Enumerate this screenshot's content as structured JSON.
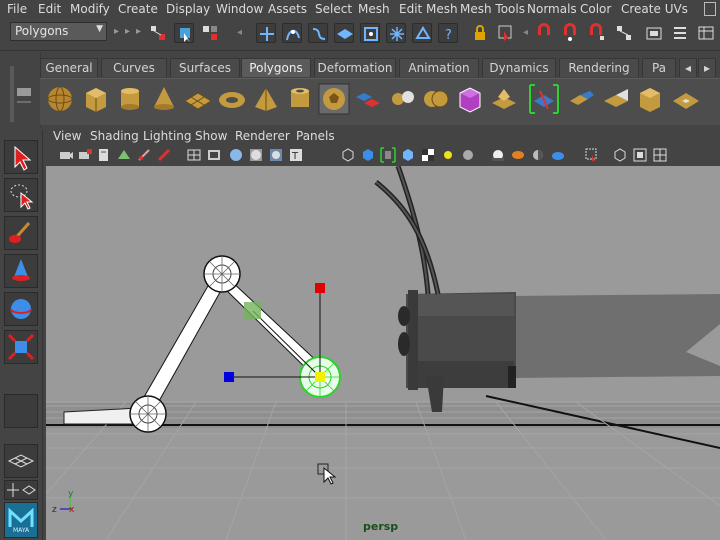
{
  "menubar": {
    "items": [
      "File",
      "Edit",
      "Modify",
      "Create",
      "Display",
      "Window",
      "Assets",
      "Select",
      "Mesh",
      "Edit Mesh",
      "Mesh Tools",
      "Normals",
      "Color",
      "Create UVs"
    ]
  },
  "status_line": {
    "mode": "Polygons"
  },
  "shelf": {
    "tabs": [
      "General",
      "Curves",
      "Surfaces",
      "Polygons",
      "Deformation",
      "Animation",
      "Dynamics",
      "Rendering",
      "Pa"
    ],
    "active_tab": "Polygons"
  },
  "panel": {
    "menu": [
      "View",
      "Shading",
      "Lighting",
      "Show",
      "Renderer",
      "Panels"
    ],
    "camera": "persp"
  },
  "axis": {
    "y": "y",
    "z": "z",
    "x": "x"
  },
  "toolbox": {
    "logo": "MAYA"
  },
  "colors": {
    "accent_green": "#2fd12f",
    "viewport_bg": "#9a9a9a",
    "manip_red": "#e00000",
    "manip_blue": "#0000e0",
    "manip_yellow": "#f0f000"
  },
  "icons": [
    "select-tool-icon",
    "lasso-tool-icon",
    "paint-select-icon",
    "move-tool-icon",
    "rotate-tool-icon",
    "scale-tool-icon"
  ]
}
